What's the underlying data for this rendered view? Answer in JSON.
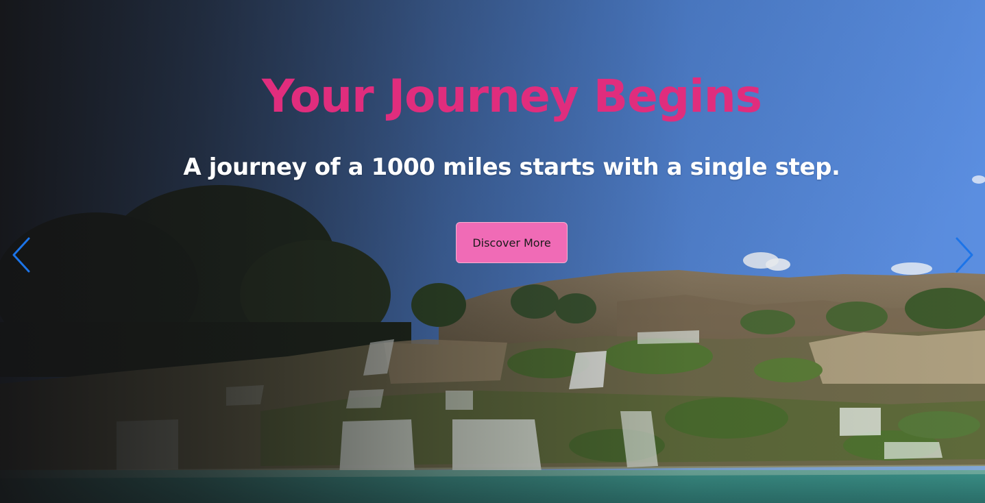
{
  "hero": {
    "headline": "Your Journey Begins",
    "subheadline": "A journey of a 1000 miles starts with a single step.",
    "cta_label": "Discover More"
  },
  "carousel": {
    "prev_icon": "chevron-left-icon",
    "next_icon": "chevron-right-icon"
  },
  "colors": {
    "headline": "#e02d7d",
    "cta_background": "#f06bb6",
    "arrow": "#1c74e8"
  }
}
